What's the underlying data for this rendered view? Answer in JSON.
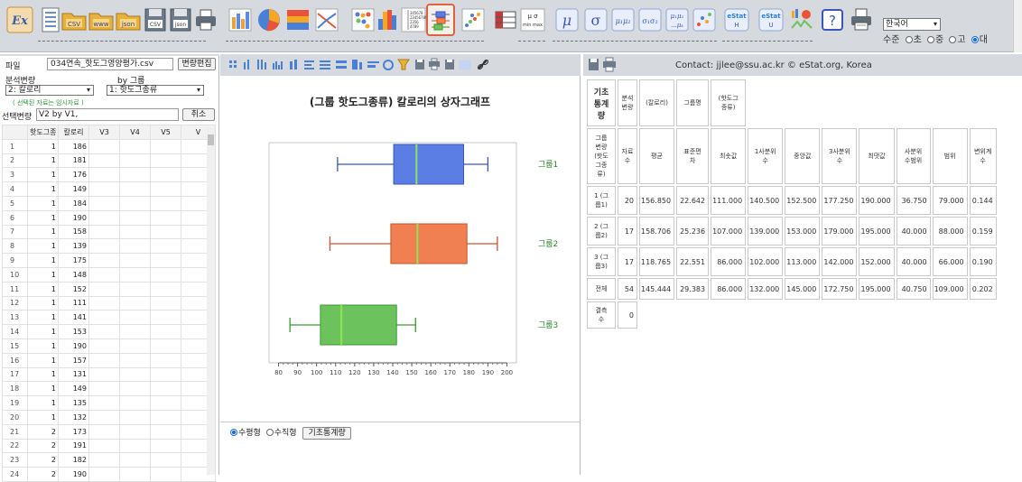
{
  "toolbar": {
    "language": "한국어",
    "level_label": "수준",
    "levels": [
      "초",
      "중",
      "고",
      "대"
    ],
    "selected_level": "대",
    "buttons": [
      "ex-icon",
      "document-icon",
      "csv-folder-icon",
      "www-folder-icon",
      "json-folder-icon",
      "save-csv-icon",
      "save-json-icon",
      "print-icon",
      "bar-chart-icon",
      "pie-chart-icon",
      "band-chart-icon",
      "line-chart-icon",
      "dot-plot-icon",
      "histogram-icon",
      "stem-leaf-icon",
      "box-plot-icon",
      "scatter-icon",
      "frequency-table-icon",
      "mean-sigma-icon",
      "mu-test-icon",
      "sigma-test-icon",
      "mu1mu2-icon",
      "sigma1sigma2-icon",
      "mu-multi-icon",
      "correlation-icon",
      "estat-h-icon",
      "estat-u-icon",
      "charts-icon",
      "help-icon",
      "print-cancel-icon"
    ],
    "ex_label": "Ex",
    "csv_label": "CSV",
    "www_label": "www",
    "json_label": "json",
    "save_csv_label": "CSV",
    "save_json_label": "json",
    "mean_label": "μ σ",
    "mean_sub": "min max",
    "mu": "μ",
    "sigma": "σ",
    "mu1mu2": "μ₁μ₂",
    "s1s2": "σ₁σ₂",
    "mu12": "μ₁μ₂",
    "mu_k": "...μₖ",
    "estat": "eStat",
    "estat_h": "H",
    "estat_u": "U",
    "help": "?",
    "stem_lines": [
      "345678",
      "23456789",
      "2356",
      "4789"
    ]
  },
  "left": {
    "file_label": "파일",
    "file_name": "034연속_핫도그영양평가.csv",
    "var_edit": "변량편집",
    "analysis_label": "분석변량",
    "by_group_label": "by 그룹",
    "analysis_value": "2: 칼로리",
    "group_value": "1: 핫도그종류",
    "hint": "( 선택된 자료는 임시자료 )",
    "selected_label": "선택변량",
    "selected_value": "V2  by  V1,",
    "cancel": "취소",
    "columns": [
      "",
      "핫도그종",
      "칼로리",
      "V3",
      "V4",
      "V5",
      "V"
    ],
    "rows": [
      [
        "1",
        "1",
        "186"
      ],
      [
        "2",
        "1",
        "181"
      ],
      [
        "3",
        "1",
        "176"
      ],
      [
        "4",
        "1",
        "149"
      ],
      [
        "5",
        "1",
        "184"
      ],
      [
        "6",
        "1",
        "190"
      ],
      [
        "7",
        "1",
        "158"
      ],
      [
        "8",
        "1",
        "139"
      ],
      [
        "9",
        "1",
        "175"
      ],
      [
        "10",
        "1",
        "148"
      ],
      [
        "11",
        "1",
        "152"
      ],
      [
        "12",
        "1",
        "111"
      ],
      [
        "13",
        "1",
        "141"
      ],
      [
        "14",
        "1",
        "153"
      ],
      [
        "15",
        "1",
        "190"
      ],
      [
        "16",
        "1",
        "157"
      ],
      [
        "17",
        "1",
        "131"
      ],
      [
        "18",
        "1",
        "149"
      ],
      [
        "19",
        "1",
        "135"
      ],
      [
        "20",
        "1",
        "132"
      ],
      [
        "21",
        "2",
        "173"
      ],
      [
        "22",
        "2",
        "191"
      ],
      [
        "23",
        "2",
        "182"
      ],
      [
        "24",
        "2",
        "190"
      ]
    ]
  },
  "chart_data": {
    "type": "boxplot",
    "title": "(그룹 핫도그종류) 칼로리의 상자그래프",
    "orientation": "horizontal",
    "xlim": [
      75,
      205
    ],
    "ticks": [
      80,
      90,
      100,
      110,
      120,
      130,
      140,
      150,
      160,
      170,
      180,
      190,
      200
    ],
    "groups": [
      {
        "name": "그룹1",
        "min": 111,
        "q1": 140.5,
        "median": 152.5,
        "q3": 177.25,
        "max": 190,
        "color": "#5b7ee5",
        "stroke": "#3a56b8"
      },
      {
        "name": "그룹2",
        "min": 107,
        "q1": 139,
        "median": 153,
        "q3": 179,
        "max": 195,
        "color": "#f07f52",
        "stroke": "#c9562c"
      },
      {
        "name": "그룹3",
        "min": 86,
        "q1": 102,
        "median": 113,
        "q3": 142,
        "max": 152,
        "color": "#6cc35e",
        "stroke": "#3d9a30"
      }
    ],
    "median_color": "#8fe35a"
  },
  "middle": {
    "orient_h": "수평형",
    "orient_v": "수직형",
    "orient_selected": "수평형",
    "stats_button": "기초통계량"
  },
  "right": {
    "contact": "Contact: jjlee@ssu.ac.kr   © eStat.org, Korea",
    "head_top": [
      "기초\n통계\n량",
      "분석\n변량",
      "(칼로리)",
      "그룹명",
      "(핫도그\n종류)"
    ],
    "header": [
      "그룹\n변량\n(핫도\n그종\n류)",
      "자료\n수",
      "평균",
      "표준편\n차",
      "최솟값",
      "1사분위\n수",
      "중앙값",
      "3사분위\n수",
      "최댓값",
      "사분위\n수범위",
      "범위",
      "변위계\n수"
    ],
    "rows": [
      [
        "1 (그\n룹1)",
        "20",
        "156.850",
        "22.642",
        "111.000",
        "140.500",
        "152.500",
        "177.250",
        "190.000",
        "36.750",
        "79.000",
        "0.144"
      ],
      [
        "2 (그\n룹2)",
        "17",
        "158.706",
        "25.236",
        "107.000",
        "139.000",
        "153.000",
        "179.000",
        "195.000",
        "40.000",
        "88.000",
        "0.159"
      ],
      [
        "3 (그\n룹3)",
        "17",
        "118.765",
        "22.551",
        "86.000",
        "102.000",
        "113.000",
        "142.000",
        "152.000",
        "40.000",
        "66.000",
        "0.190"
      ],
      [
        "전체",
        "54",
        "145.444",
        "29.383",
        "86.000",
        "132.000",
        "145.000",
        "172.750",
        "195.000",
        "40.750",
        "109.000",
        "0.202"
      ]
    ],
    "missing_label": "결측\n수",
    "missing_value": "0"
  }
}
